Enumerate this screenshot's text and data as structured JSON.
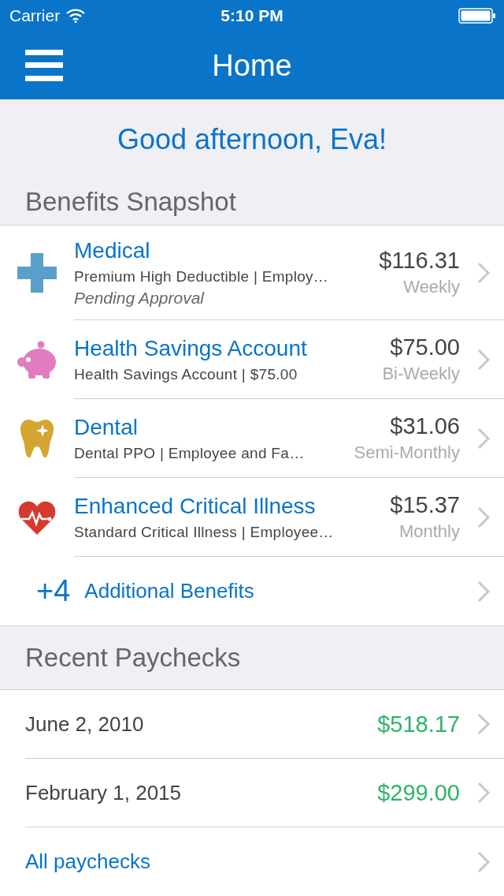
{
  "status_bar": {
    "carrier": "Carrier",
    "time": "5:10 PM"
  },
  "nav": {
    "title": "Home"
  },
  "greeting": "Good afternoon, Eva!",
  "benefits": {
    "title": "Benefits Snapshot",
    "items": [
      {
        "kind": "medical",
        "color": "#5a9fc9",
        "name": "Medical",
        "detail": "Premium High Deductible | Employ…",
        "status": "Pending Approval",
        "amount": "$116.31",
        "frequency": "Weekly"
      },
      {
        "kind": "savings",
        "color": "#e27cc0",
        "name": "Health Savings Account",
        "detail": "Health Savings Account | $75.00",
        "amount": "$75.00",
        "frequency": "Bi-Weekly"
      },
      {
        "kind": "dental",
        "color": "#d4a531",
        "name": "Dental",
        "detail": "Dental PPO | Employee and Fa…",
        "amount": "$31.06",
        "frequency": "Semi-Monthly"
      },
      {
        "kind": "illness",
        "color": "#d63a2f",
        "name": "Enhanced Critical Illness",
        "detail": "Standard Critical Illness | Employee…",
        "amount": "$15.37",
        "frequency": "Monthly"
      }
    ],
    "additional": {
      "count": "+4",
      "label": "Additional Benefits"
    }
  },
  "paychecks": {
    "title": "Recent Paychecks",
    "items": [
      {
        "date": "June 2, 2010",
        "amount": "$518.17"
      },
      {
        "date": "February 1, 2015",
        "amount": "$299.00"
      }
    ],
    "all_link": "All paychecks"
  }
}
